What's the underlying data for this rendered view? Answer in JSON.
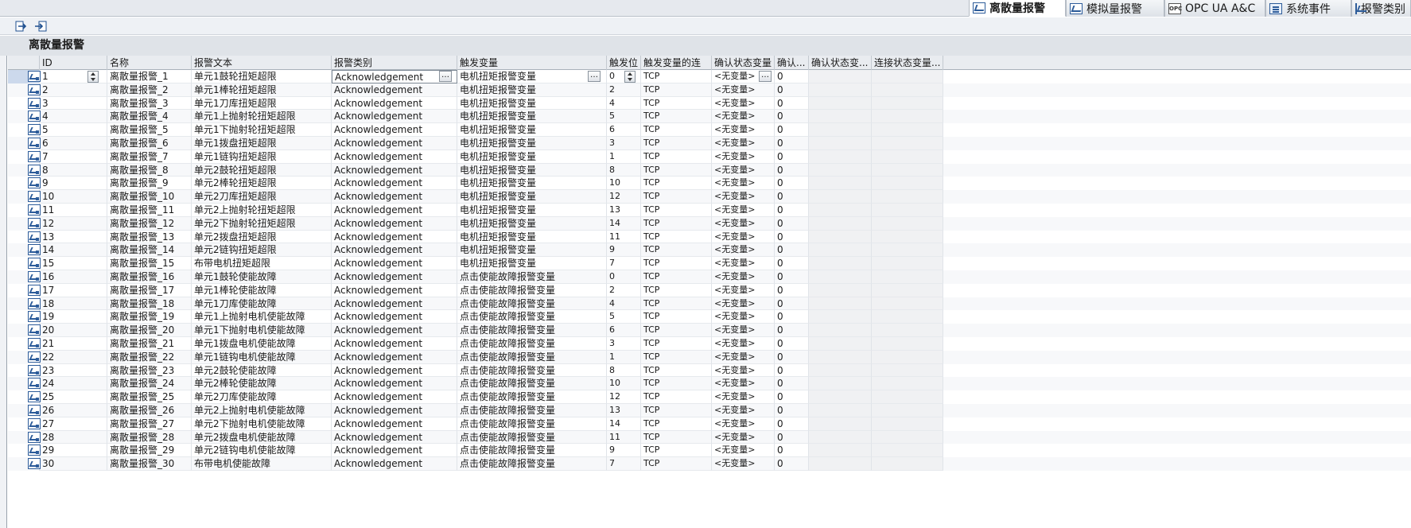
{
  "tabs": [
    {
      "label": "离散量报警",
      "icon": "discrete-alarm-icon",
      "active": true
    },
    {
      "label": "模拟量报警",
      "icon": "analog-alarm-icon",
      "active": false
    },
    {
      "label": "OPC UA A&C",
      "icon": "opc-icon",
      "active": false
    },
    {
      "label": "系统事件",
      "icon": "system-event-icon",
      "active": false
    },
    {
      "label": "报警类别",
      "icon": "alarm-class-icon",
      "active": false
    }
  ],
  "toolbar": {
    "icons": [
      "insert-row-icon",
      "export-icon"
    ]
  },
  "section_title": "离散量报警",
  "columns": [
    "ID",
    "名称",
    "报警文本",
    "报警类别",
    "触发变量",
    "触发位",
    "触发变量的连",
    "确认状态变量",
    "确认...",
    "确认状态变...",
    "连接状态变量..."
  ],
  "rows": [
    {
      "id": "1",
      "name": "离散量报警_1",
      "text": "单元1鼓轮扭矩超限",
      "class": "Acknowledgement",
      "trigger": "电机扭矩报警变量",
      "bit": "0",
      "conn": "TCP",
      "ack": "<无变量>",
      "ackbit": "0"
    },
    {
      "id": "2",
      "name": "离散量报警_2",
      "text": "单元1棒轮扭矩超限",
      "class": "Acknowledgement",
      "trigger": "电机扭矩报警变量",
      "bit": "2",
      "conn": "TCP",
      "ack": "<无变量>",
      "ackbit": "0"
    },
    {
      "id": "3",
      "name": "离散量报警_3",
      "text": "单元1刀库扭矩超限",
      "class": "Acknowledgement",
      "trigger": "电机扭矩报警变量",
      "bit": "4",
      "conn": "TCP",
      "ack": "<无变量>",
      "ackbit": "0"
    },
    {
      "id": "4",
      "name": "离散量报警_4",
      "text": "单元1上抛射轮扭矩超限",
      "class": "Acknowledgement",
      "trigger": "电机扭矩报警变量",
      "bit": "5",
      "conn": "TCP",
      "ack": "<无变量>",
      "ackbit": "0"
    },
    {
      "id": "5",
      "name": "离散量报警_5",
      "text": "单元1下抛射轮扭矩超限",
      "class": "Acknowledgement",
      "trigger": "电机扭矩报警变量",
      "bit": "6",
      "conn": "TCP",
      "ack": "<无变量>",
      "ackbit": "0"
    },
    {
      "id": "6",
      "name": "离散量报警_6",
      "text": "单元1拨盘扭矩超限",
      "class": "Acknowledgement",
      "trigger": "电机扭矩报警变量",
      "bit": "3",
      "conn": "TCP",
      "ack": "<无变量>",
      "ackbit": "0"
    },
    {
      "id": "7",
      "name": "离散量报警_7",
      "text": "单元1链钩扭矩超限",
      "class": "Acknowledgement",
      "trigger": "电机扭矩报警变量",
      "bit": "1",
      "conn": "TCP",
      "ack": "<无变量>",
      "ackbit": "0"
    },
    {
      "id": "8",
      "name": "离散量报警_8",
      "text": "单元2鼓轮扭矩超限",
      "class": "Acknowledgement",
      "trigger": "电机扭矩报警变量",
      "bit": "8",
      "conn": "TCP",
      "ack": "<无变量>",
      "ackbit": "0"
    },
    {
      "id": "9",
      "name": "离散量报警_9",
      "text": "单元2棒轮扭矩超限",
      "class": "Acknowledgement",
      "trigger": "电机扭矩报警变量",
      "bit": "10",
      "conn": "TCP",
      "ack": "<无变量>",
      "ackbit": "0"
    },
    {
      "id": "10",
      "name": "离散量报警_10",
      "text": "单元2刀库扭矩超限",
      "class": "Acknowledgement",
      "trigger": "电机扭矩报警变量",
      "bit": "12",
      "conn": "TCP",
      "ack": "<无变量>",
      "ackbit": "0"
    },
    {
      "id": "11",
      "name": "离散量报警_11",
      "text": "单元2上抛射轮扭矩超限",
      "class": "Acknowledgement",
      "trigger": "电机扭矩报警变量",
      "bit": "13",
      "conn": "TCP",
      "ack": "<无变量>",
      "ackbit": "0"
    },
    {
      "id": "12",
      "name": "离散量报警_12",
      "text": "单元2下抛射轮扭矩超限",
      "class": "Acknowledgement",
      "trigger": "电机扭矩报警变量",
      "bit": "14",
      "conn": "TCP",
      "ack": "<无变量>",
      "ackbit": "0"
    },
    {
      "id": "13",
      "name": "离散量报警_13",
      "text": "单元2拨盘扭矩超限",
      "class": "Acknowledgement",
      "trigger": "电机扭矩报警变量",
      "bit": "11",
      "conn": "TCP",
      "ack": "<无变量>",
      "ackbit": "0"
    },
    {
      "id": "14",
      "name": "离散量报警_14",
      "text": "单元2链钩扭矩超限",
      "class": "Acknowledgement",
      "trigger": "电机扭矩报警变量",
      "bit": "9",
      "conn": "TCP",
      "ack": "<无变量>",
      "ackbit": "0"
    },
    {
      "id": "15",
      "name": "离散量报警_15",
      "text": "布带电机扭矩超限",
      "class": "Acknowledgement",
      "trigger": "电机扭矩报警变量",
      "bit": "7",
      "conn": "TCP",
      "ack": "<无变量>",
      "ackbit": "0"
    },
    {
      "id": "16",
      "name": "离散量报警_16",
      "text": "单元1鼓轮使能故障",
      "class": "Acknowledgement",
      "trigger": "点击使能故障报警变量",
      "bit": "0",
      "conn": "TCP",
      "ack": "<无变量>",
      "ackbit": "0"
    },
    {
      "id": "17",
      "name": "离散量报警_17",
      "text": "单元1棒轮使能故障",
      "class": "Acknowledgement",
      "trigger": "点击使能故障报警变量",
      "bit": "2",
      "conn": "TCP",
      "ack": "<无变量>",
      "ackbit": "0"
    },
    {
      "id": "18",
      "name": "离散量报警_18",
      "text": "单元1刀库使能故障",
      "class": "Acknowledgement",
      "trigger": "点击使能故障报警变量",
      "bit": "4",
      "conn": "TCP",
      "ack": "<无变量>",
      "ackbit": "0"
    },
    {
      "id": "19",
      "name": "离散量报警_19",
      "text": "单元1上抛射电机使能故障",
      "class": "Acknowledgement",
      "trigger": "点击使能故障报警变量",
      "bit": "5",
      "conn": "TCP",
      "ack": "<无变量>",
      "ackbit": "0"
    },
    {
      "id": "20",
      "name": "离散量报警_20",
      "text": "单元1下抛射电机使能故障",
      "class": "Acknowledgement",
      "trigger": "点击使能故障报警变量",
      "bit": "6",
      "conn": "TCP",
      "ack": "<无变量>",
      "ackbit": "0"
    },
    {
      "id": "21",
      "name": "离散量报警_21",
      "text": "单元1拨盘电机使能故障",
      "class": "Acknowledgement",
      "trigger": "点击使能故障报警变量",
      "bit": "3",
      "conn": "TCP",
      "ack": "<无变量>",
      "ackbit": "0"
    },
    {
      "id": "22",
      "name": "离散量报警_22",
      "text": "单元1链钩电机使能故障",
      "class": "Acknowledgement",
      "trigger": "点击使能故障报警变量",
      "bit": "1",
      "conn": "TCP",
      "ack": "<无变量>",
      "ackbit": "0"
    },
    {
      "id": "23",
      "name": "离散量报警_23",
      "text": "单元2鼓轮使能故障",
      "class": "Acknowledgement",
      "trigger": "点击使能故障报警变量",
      "bit": "8",
      "conn": "TCP",
      "ack": "<无变量>",
      "ackbit": "0"
    },
    {
      "id": "24",
      "name": "离散量报警_24",
      "text": "单元2棒轮使能故障",
      "class": "Acknowledgement",
      "trigger": "点击使能故障报警变量",
      "bit": "10",
      "conn": "TCP",
      "ack": "<无变量>",
      "ackbit": "0"
    },
    {
      "id": "25",
      "name": "离散量报警_25",
      "text": "单元2刀库使能故障",
      "class": "Acknowledgement",
      "trigger": "点击使能故障报警变量",
      "bit": "12",
      "conn": "TCP",
      "ack": "<无变量>",
      "ackbit": "0"
    },
    {
      "id": "26",
      "name": "离散量报警_26",
      "text": "单元2上抛射电机使能故障",
      "class": "Acknowledgement",
      "trigger": "点击使能故障报警变量",
      "bit": "13",
      "conn": "TCP",
      "ack": "<无变量>",
      "ackbit": "0"
    },
    {
      "id": "27",
      "name": "离散量报警_27",
      "text": "单元2下抛射电机使能故障",
      "class": "Acknowledgement",
      "trigger": "点击使能故障报警变量",
      "bit": "14",
      "conn": "TCP",
      "ack": "<无变量>",
      "ackbit": "0"
    },
    {
      "id": "28",
      "name": "离散量报警_28",
      "text": "单元2拨盘电机使能故障",
      "class": "Acknowledgement",
      "trigger": "点击使能故障报警变量",
      "bit": "11",
      "conn": "TCP",
      "ack": "<无变量>",
      "ackbit": "0"
    },
    {
      "id": "29",
      "name": "离散量报警_29",
      "text": "单元2链钩电机使能故障",
      "class": "Acknowledgement",
      "trigger": "点击使能故障报警变量",
      "bit": "9",
      "conn": "TCP",
      "ack": "<无变量>",
      "ackbit": "0"
    },
    {
      "id": "30",
      "name": "离散量报警_30",
      "text": "布带电机使能故障",
      "class": "Acknowledgement",
      "trigger": "点击使能故障报警变量",
      "bit": "7",
      "conn": "TCP",
      "ack": "<无变量>",
      "ackbit": "0"
    }
  ],
  "colors": {
    "selected_row": "#ccd9ec",
    "icon_blue": "#2d5c9a",
    "header_bg": "#e9ecf0"
  }
}
